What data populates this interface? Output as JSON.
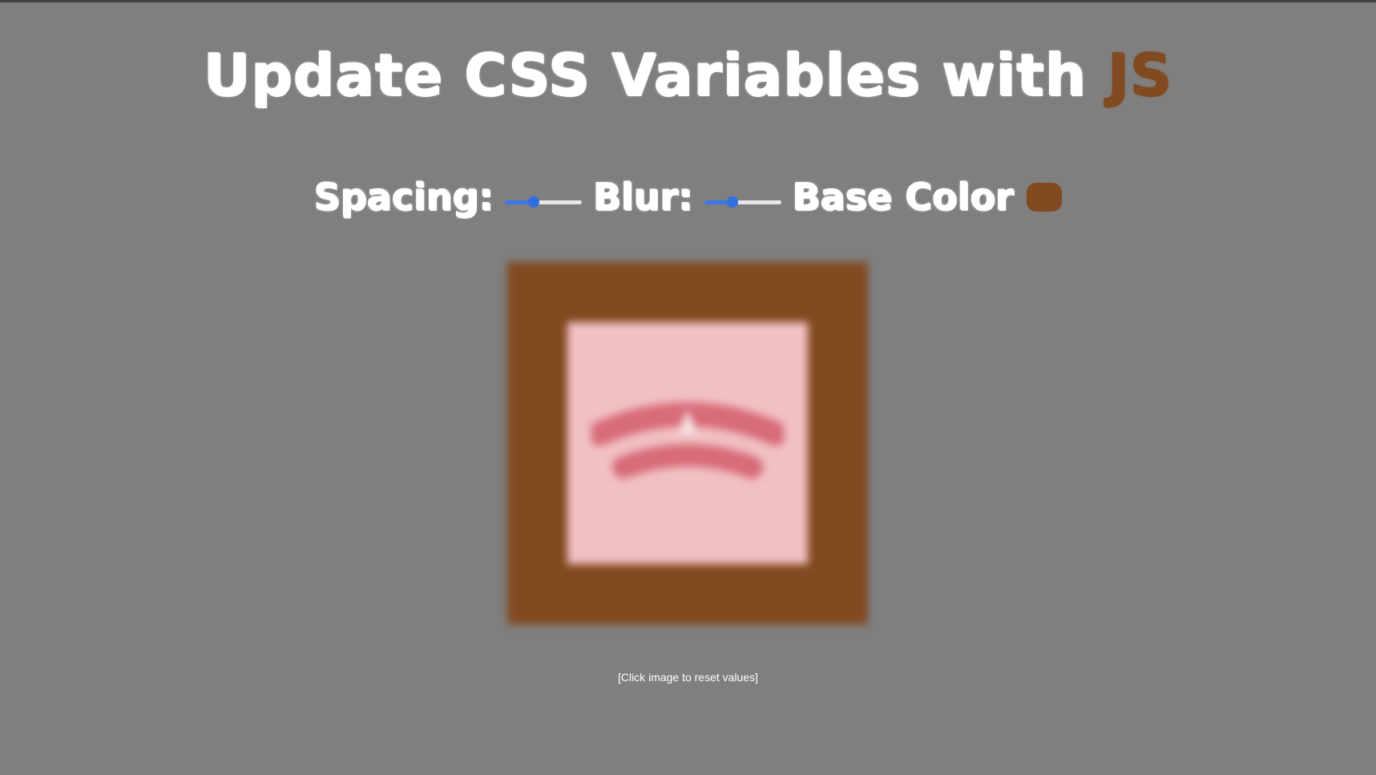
{
  "header": {
    "title_main": "Update CSS Variables with",
    "title_accent": "JS"
  },
  "controls": {
    "spacing_label": "Spacing:",
    "spacing_value_fraction": 0.37,
    "blur_label": "Blur:",
    "blur_value_fraction": 0.37,
    "base_color_label": "Base Color",
    "base_color_value": "#824a20"
  },
  "image": {
    "frame_color": "#824a20",
    "inner_color": "#f0c0c4",
    "logo_color": "#d86b78",
    "logo_icon": "blurred-badge-logo"
  },
  "caption": "[Click image to reset values]",
  "colors": {
    "background": "#7f7f7f",
    "text": "#ffffff",
    "accent": "#824a20",
    "slider_fill": "#3b78e7",
    "slider_track": "#e6e6e6"
  }
}
